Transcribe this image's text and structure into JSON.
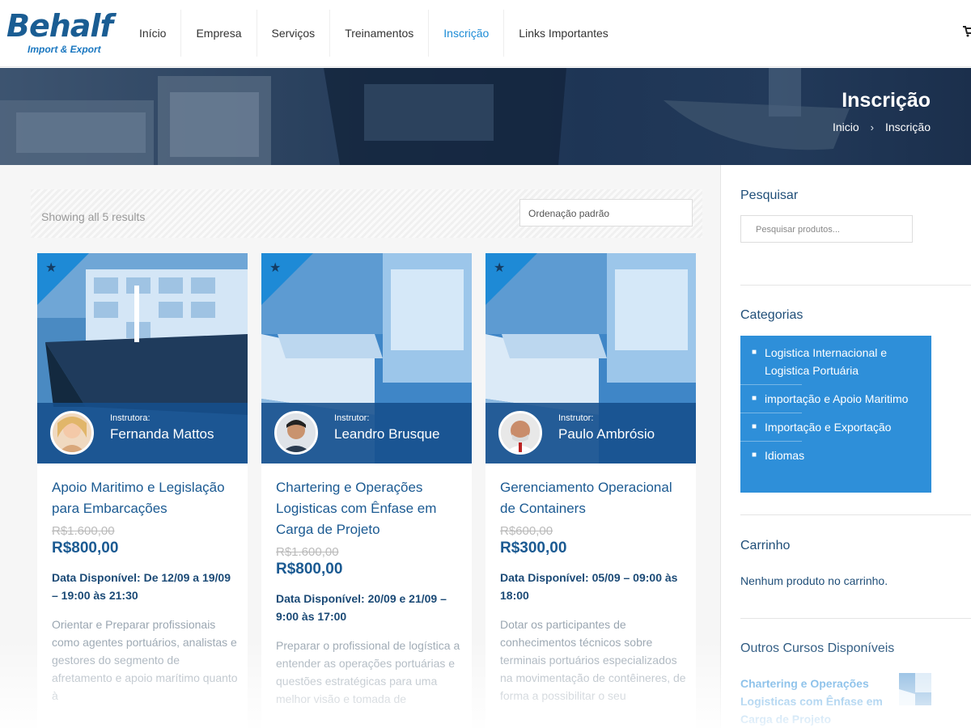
{
  "logo": {
    "name": "Behalf",
    "tagline": "Import & Export"
  },
  "nav": [
    "Início",
    "Empresa",
    "Serviços",
    "Treinamentos",
    "Inscrição",
    "Links Importantes"
  ],
  "nav_active": "Inscrição",
  "banner": {
    "title": "Inscrição",
    "breadcrumb": [
      "Inicio",
      "Inscrição"
    ],
    "separator": "›"
  },
  "shop": {
    "results": "Showing all 5 results",
    "sort": "Ordenação padrão"
  },
  "products": [
    {
      "instructor_role": "Instrutora:",
      "instructor_name": "Fernanda Mattos",
      "title": "Apoio Maritimo e Legislação para Embarcações",
      "old_price": "R$1.600,00",
      "price": "R$800,00",
      "date": "Data Disponível: De 12/09 a 19/09 – 19:00 às 21:30",
      "description": "Orientar e Preparar profissionais como agentes portuários, analistas e gestores do segmento de afretamento e apoio marítimo quanto à"
    },
    {
      "instructor_role": "Instrutor:",
      "instructor_name": "Leandro Brusque",
      "title": "Chartering e Operações Logisticas com Ênfase em Carga de Projeto",
      "old_price": "R$1.600,00",
      "price": "R$800,00",
      "date": "Data Disponível: 20/09 e 21/09 – 9:00 às 17:00",
      "description": "Preparar o profissional de logística a entender as operações portuárias e questões estratégicas para uma melhor visão e tomada de"
    },
    {
      "instructor_role": "Instrutor:",
      "instructor_name": "Paulo Ambrósio",
      "title": "Gerenciamento Operacional de Containers",
      "old_price": "R$600,00",
      "price": "R$300,00",
      "date": "Data Disponível: 05/09 – 09:00 às 18:00",
      "description": "Dotar os participantes de conhecimentos técnicos sobre terminais portuários especializados na movimentação de contêineres, de forma a possibilitar o seu"
    }
  ],
  "sidebar": {
    "search_title": "Pesquisar",
    "search_placeholder": "Pesquisar produtos...",
    "categories_title": "Categorias",
    "categories": [
      "Logistica Internacional e Logistica Portuária",
      "importação e Apoio Maritimo",
      "Importação e Exportação",
      "Idiomas"
    ],
    "cart_title": "Carrinho",
    "cart_empty": "Nenhum produto no carrinho.",
    "other_title": "Outros Cursos Disponíveis",
    "other_course": "Chartering e Operações Logisticas com Ênfase em Carga de Projeto"
  },
  "colors": {
    "accent": "#1d8cd6",
    "title_blue": "#1b5a92",
    "category_bg": "#2e8fd9",
    "banner": "#1e3555"
  }
}
